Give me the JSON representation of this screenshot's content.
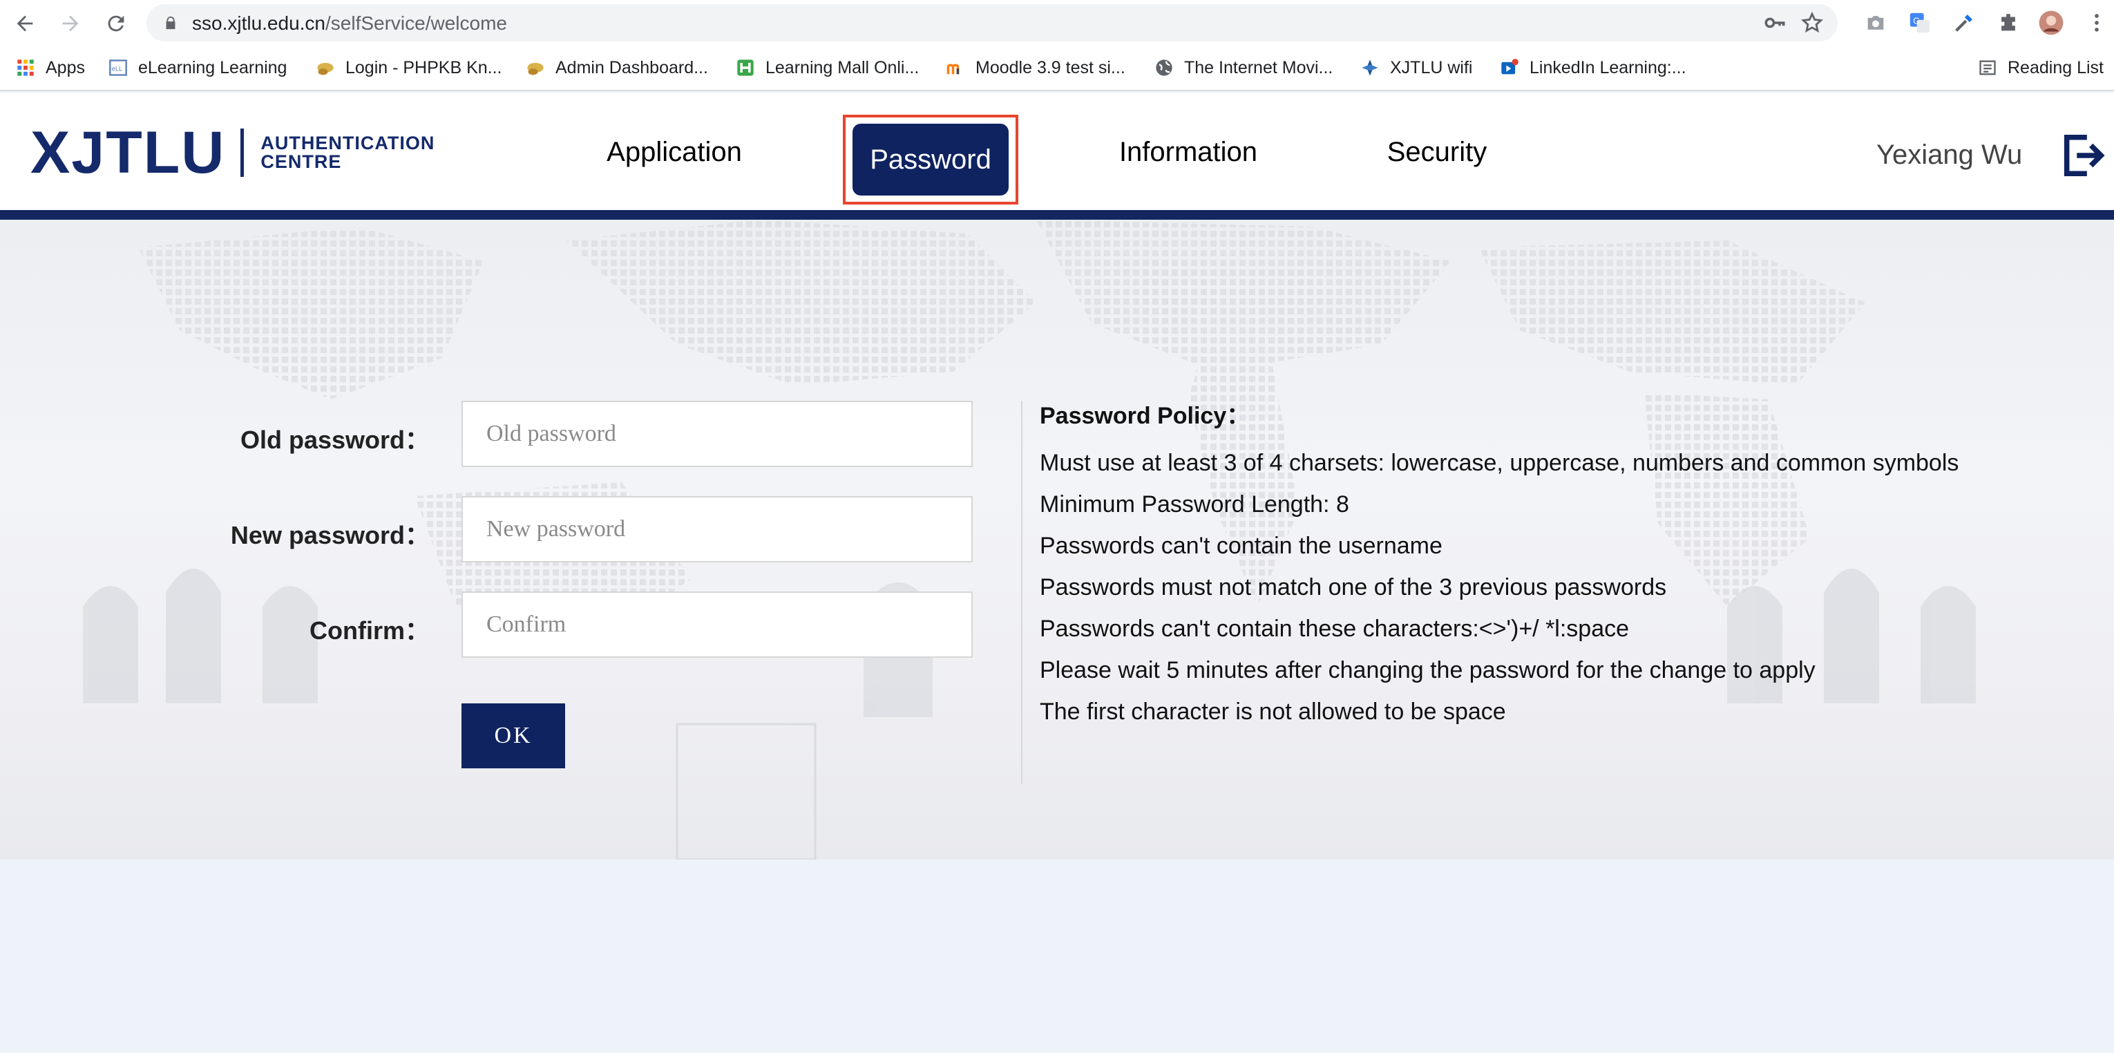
{
  "browser": {
    "url_host": "sso.xjtlu.edu.cn",
    "url_path": "/selfService/welcome",
    "bookmarks": [
      {
        "label": "Apps",
        "icon": "apps-grid-icon"
      },
      {
        "label": "eLearning Learning",
        "icon": "elearning-icon"
      },
      {
        "label": "Login - PHPKB Kn...",
        "icon": "phpkb-icon"
      },
      {
        "label": "Admin Dashboard...",
        "icon": "phpkb-icon"
      },
      {
        "label": "Learning Mall Onli...",
        "icon": "learning-mall-icon"
      },
      {
        "label": "Moodle 3.9 test si...",
        "icon": "moodle-icon"
      },
      {
        "label": "The Internet Movi...",
        "icon": "globe-icon"
      },
      {
        "label": "XJTLU wifi",
        "icon": "xjtlu-icon"
      },
      {
        "label": "LinkedIn Learning:...",
        "icon": "linkedin-icon"
      }
    ],
    "reading_list": "Reading List"
  },
  "header": {
    "logo_main": "XJTLU",
    "logo_sub_line1": "AUTHENTICATION",
    "logo_sub_line2": "CENTRE",
    "menu": {
      "application": "Application",
      "password": "Password",
      "information": "Information",
      "security": "Security"
    },
    "user_name": "Yexiang Wu",
    "brand_color": "#0f2360",
    "highlight_color": "#e8452c"
  },
  "form": {
    "old_label": "Old password：",
    "old_placeholder": "Old password",
    "new_label": "New password：",
    "new_placeholder": "New password",
    "confirm_label": "Confirm：",
    "confirm_placeholder": "Confirm",
    "ok_label": "OK"
  },
  "policy": {
    "title": "Password Policy：",
    "rules": [
      "Must use at least 3 of 4 charsets: lowercase, uppercase, numbers and common symbols",
      "Minimum Password Length: 8",
      "Passwords can't contain the username",
      "Passwords must not match one of the 3 previous passwords",
      "Passwords can't contain these characters:<>')+/ *l:space",
      "Please wait 5 minutes after changing the password for the change to apply",
      "The first character is not allowed to be space"
    ]
  }
}
